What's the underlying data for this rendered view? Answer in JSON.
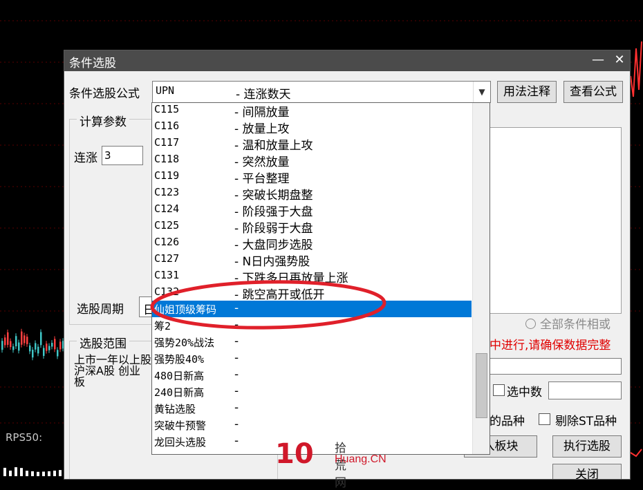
{
  "background": {
    "rps_label": "RPS50:"
  },
  "dialog": {
    "title": "条件选股",
    "minimize_glyph": "—",
    "close_glyph": "✕",
    "formula_label": "条件选股公式",
    "formula_selected_code": "UPN",
    "formula_selected_name": "- 连涨数天",
    "usage_button": "用法注释",
    "view_formula_button": "查看公式",
    "calc_params_title": "计算参数",
    "lianzhang_label": "连涨",
    "lianzhang_value": "3",
    "period_label": "选股周期",
    "period_value_partial": "日",
    "all_conditions_label": "全部条件相或",
    "warning_text": "中进行,请确保数据完整",
    "selected_count_label": "选中数",
    "scope_title": "选股范围",
    "scope_list_text": "上市一年以上股 沪深A股 创业板",
    "varieties_label": "的品种",
    "exclude_st_label": "剔除ST品种",
    "add_to_block_button": "入板块",
    "execute_button": "执行选股",
    "close_button": "关闭"
  },
  "dropdown": {
    "items": [
      {
        "code": "C115",
        "name": "- 间隔放量"
      },
      {
        "code": "C116",
        "name": "- 放量上攻"
      },
      {
        "code": "C117",
        "name": "- 温和放量上攻"
      },
      {
        "code": "C118",
        "name": "- 突然放量"
      },
      {
        "code": "C119",
        "name": "- 平台整理"
      },
      {
        "code": "C123",
        "name": "- 突破长期盘整"
      },
      {
        "code": "C124",
        "name": "- 阶段强于大盘"
      },
      {
        "code": "C125",
        "name": "- 阶段弱于大盘"
      },
      {
        "code": "C126",
        "name": "- 大盘同步选股"
      },
      {
        "code": "C127",
        "name": "- N日内强势股"
      },
      {
        "code": "C131",
        "name": "- 下跌多日再放量上涨"
      },
      {
        "code": "C132",
        "name": "- 跳空高开或低开"
      },
      {
        "code": "仙姐顶级筹码",
        "name": "-"
      },
      {
        "code": "筹2",
        "name": "-"
      },
      {
        "code": "强势20%战法",
        "name": "-"
      },
      {
        "code": "强势股40%",
        "name": "-"
      },
      {
        "code": "480日新高",
        "name": "-"
      },
      {
        "code": "240日新高",
        "name": "-"
      },
      {
        "code": "黄钻选股",
        "name": "-"
      },
      {
        "code": "突破牛预警",
        "name": "-"
      },
      {
        "code": "龙回头选股",
        "name": "-"
      }
    ],
    "selected_index": 12
  },
  "watermark": {
    "logo": "10",
    "cn": "拾荒网",
    "en": "Huang.CN"
  },
  "colors": {
    "selection": "#0078d7",
    "warning": "#e00000",
    "ellipse": "#e0202a"
  }
}
